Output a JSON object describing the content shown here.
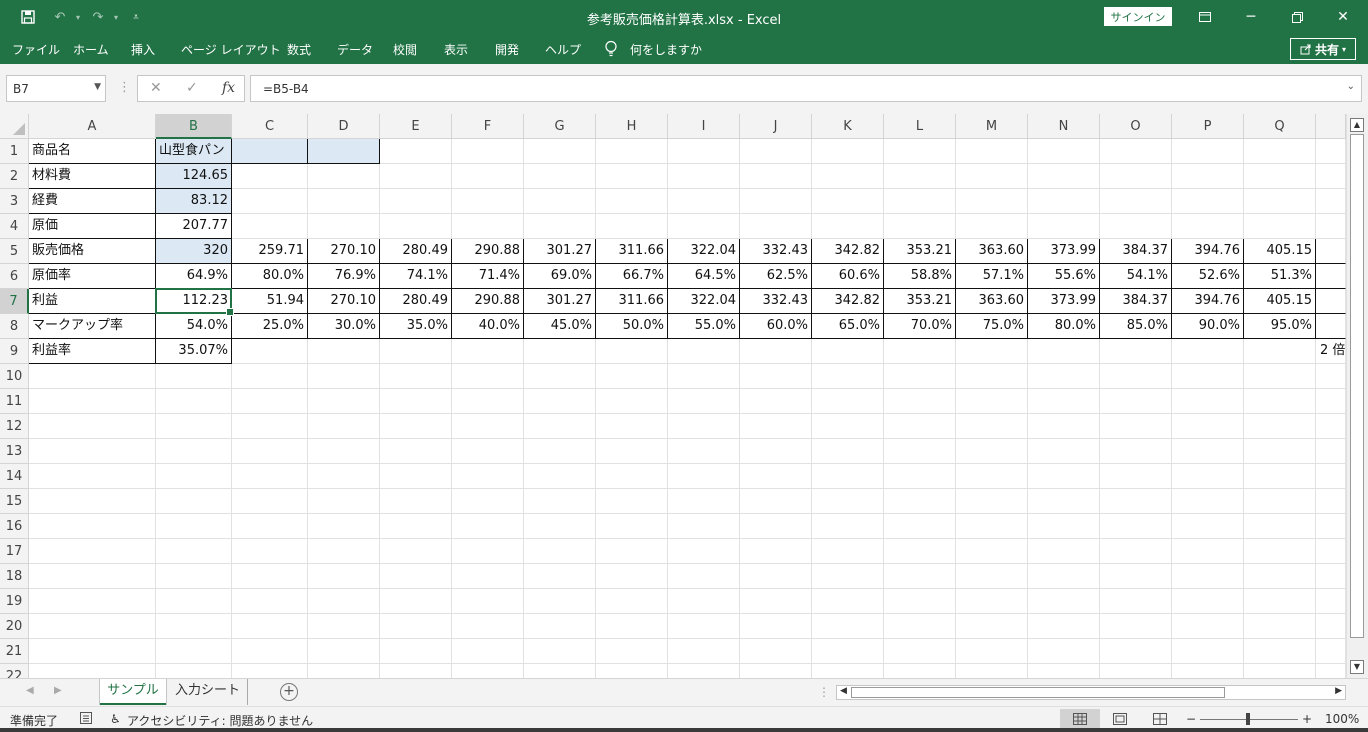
{
  "titlebar": {
    "title": "参考販売価格計算表.xlsx  -  Excel",
    "signin": "サインイン"
  },
  "ribbon": {
    "tabs": [
      "ファイル",
      "ホーム",
      "挿入",
      "ページ レイアウト",
      "数式",
      "データ",
      "校閲",
      "表示",
      "開発",
      "ヘルプ"
    ],
    "tellme": "何をしますか",
    "share": "共有"
  },
  "formula_bar": {
    "name_box": "B7",
    "formula": "=B5-B4"
  },
  "grid": {
    "columns": [
      "A",
      "B",
      "C",
      "D",
      "E",
      "F",
      "G",
      "H",
      "I",
      "J",
      "K",
      "L",
      "M",
      "N",
      "O",
      "P",
      "Q"
    ],
    "row_numbers": [
      "1",
      "2",
      "3",
      "4",
      "5",
      "6",
      "7",
      "8",
      "9",
      "10",
      "11",
      "12",
      "13",
      "14",
      "15",
      "16",
      "17",
      "18",
      "19",
      "20",
      "21",
      "22"
    ],
    "selected_column": "B",
    "selected_row": "7",
    "rows": [
      [
        "商品名",
        "山型食パン",
        "",
        "",
        "",
        "",
        "",
        "",
        "",
        "",
        "",
        "",
        "",
        "",
        "",
        "",
        ""
      ],
      [
        "材料費",
        "124.65",
        "",
        "",
        "",
        "",
        "",
        "",
        "",
        "",
        "",
        "",
        "",
        "",
        "",
        "",
        ""
      ],
      [
        "経費",
        "83.12",
        "",
        "",
        "",
        "",
        "",
        "",
        "",
        "",
        "",
        "",
        "",
        "",
        "",
        "",
        ""
      ],
      [
        "原価",
        "207.77",
        "",
        "",
        "",
        "",
        "",
        "",
        "",
        "",
        "",
        "",
        "",
        "",
        "",
        "",
        ""
      ],
      [
        "販売価格",
        "320",
        "259.71",
        "270.10",
        "280.49",
        "290.88",
        "301.27",
        "311.66",
        "322.04",
        "332.43",
        "342.82",
        "353.21",
        "363.60",
        "373.99",
        "384.37",
        "394.76",
        "405.15"
      ],
      [
        "原価率",
        "64.9%",
        "80.0%",
        "76.9%",
        "74.1%",
        "71.4%",
        "69.0%",
        "66.7%",
        "64.5%",
        "62.5%",
        "60.6%",
        "58.8%",
        "57.1%",
        "55.6%",
        "54.1%",
        "52.6%",
        "51.3%"
      ],
      [
        "利益",
        "112.23",
        "51.94",
        "270.10",
        "280.49",
        "290.88",
        "301.27",
        "311.66",
        "322.04",
        "332.43",
        "342.82",
        "353.21",
        "363.60",
        "373.99",
        "384.37",
        "394.76",
        "405.15"
      ],
      [
        "マークアップ率",
        "54.0%",
        "25.0%",
        "30.0%",
        "35.0%",
        "40.0%",
        "45.0%",
        "50.0%",
        "55.0%",
        "60.0%",
        "65.0%",
        "70.0%",
        "75.0%",
        "80.0%",
        "85.0%",
        "90.0%",
        "95.0%"
      ],
      [
        "利益率",
        "35.07%",
        "",
        "",
        "",
        "",
        "",
        "",
        "",
        "",
        "",
        "",
        "",
        "",
        "",
        "",
        ""
      ]
    ],
    "overflow_text_row9": "2 倍"
  },
  "sheets": {
    "tabs": [
      "サンプル",
      "入力シート"
    ],
    "active_index": 0
  },
  "status": {
    "ready": "準備完了",
    "accessibility": "アクセシビリティ: 問題ありません",
    "zoom": "100%",
    "zoom_level_percent": 100
  },
  "colors": {
    "excel_green": "#217346",
    "input_fill": "#dce9f5"
  }
}
